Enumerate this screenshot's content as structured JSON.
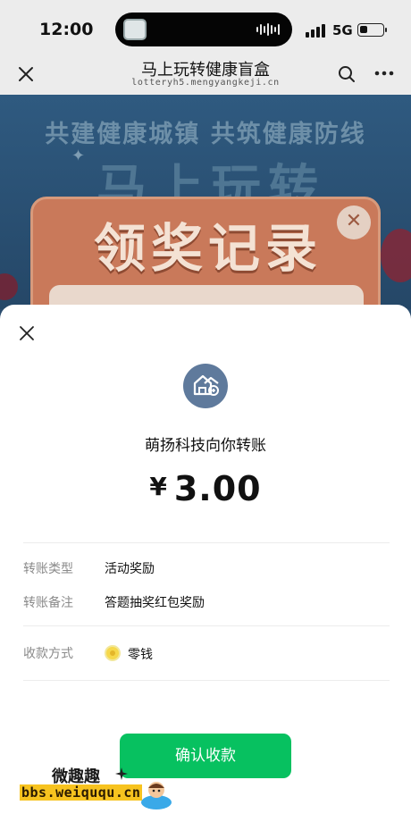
{
  "status_bar": {
    "time": "12:00",
    "network": "5G",
    "battery_level": 0.35
  },
  "nav": {
    "title": "马上玩转健康盲盒",
    "url": "lotteryh5.mengyangkeji.cn"
  },
  "game": {
    "slogan": "共建健康城镇 共筑健康防线",
    "logo": "马上玩转",
    "card_title": "领奖记录",
    "card_close": "✕"
  },
  "transfer": {
    "payer_text": "萌扬科技向你转账",
    "currency": "¥",
    "amount": "3.00",
    "rows": [
      {
        "label": "转账类型",
        "value": "活动奖励"
      },
      {
        "label": "转账备注",
        "value": "答题抽奖红包奖励"
      }
    ],
    "method_label": "收款方式",
    "method_value": "零钱",
    "confirm_label": "确认收款"
  },
  "watermark": {
    "title": "微趣趣",
    "url": "bbs.weiququ.cn"
  },
  "colors": {
    "accent_green": "#07c160",
    "avatar_bg": "#5f7a9c",
    "coin": "#f6d84b"
  },
  "icons": [
    "close-icon",
    "search-icon",
    "more-icon",
    "merchant-store-icon",
    "coin-icon"
  ]
}
